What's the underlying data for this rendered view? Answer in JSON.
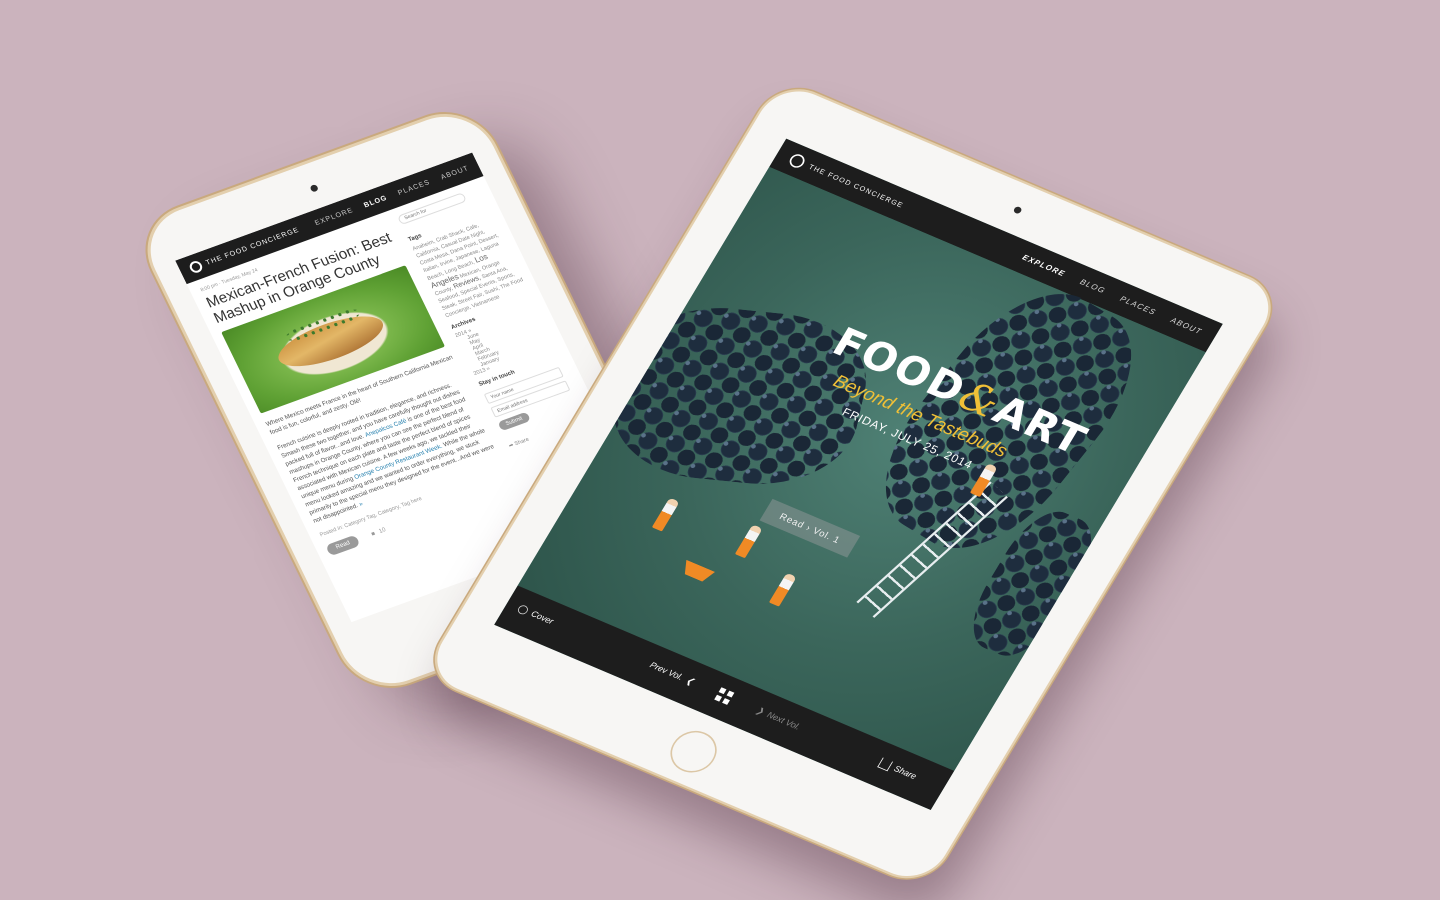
{
  "colors": {
    "background": "#cbb3bd",
    "nav_dark": "#1d1d1d",
    "hero_teal": "#3e6a60",
    "accent_yellow": "#f0c037",
    "link_blue": "#2a83b0",
    "worker_orange": "#f08a25"
  },
  "left_tablet": {
    "nav": {
      "brand": "THE FOOD CONCIERGE",
      "items": [
        "EXPLORE",
        "BLOG",
        "PLACES",
        "ABOUT"
      ],
      "active": "BLOG"
    },
    "post": {
      "meta": "8:00 pm · Tuesday, May 24",
      "title": "Mexican-French Fusion: Best Mashup in Orange County",
      "paragraph1": "Where Mexico meets France in the heart of Southern California Mexican food is fun, colorful, and zesty. Olé!",
      "paragraph2_before": "French cuisine is deeply rooted in tradition, elegance, and richness. Smash these two together, and you have carefully thought out dishes packed full of flavor...and love.",
      "link1": "Anepalcos Café",
      "paragraph2_mid": "is one of the best food mashups in Orange County, where you can see the perfect blend of French technique on each plate and taste the perfect blend of spices associated with Mexican cuisine. A few weeks ago, we tackled their unique menu during",
      "link2": "Orange County Restaurant Week.",
      "paragraph2_after": "While the whole menu looked amazing and we wanted to order everything, we stuck primarily to the special menu they designed for the event...And we were not disappointed.",
      "more_link": "»",
      "footer": "Posted in: Category Tag, Category, Tag here",
      "read_label": "Read",
      "comment_count": "10"
    },
    "sidebar": {
      "search_placeholder": "Search for",
      "tags_heading": "Tags",
      "tags_text": "Anaheim, Crab Shack, Cafe, California, Casual Date Night, Costa Mesa, Dana Point, Dessert, Italian, Irvine, Japanese, Laguna Beach, Long Beach,",
      "tags_big": "Los Angeles",
      "tags_more": "Mexican, Orange County,",
      "tags_reviews": "Reviews,",
      "tags_end": "Santa Ana, Seafood, Special Events, Sports, Steak, Street Fair, Sushi, The Food Concierge, Vietnamese",
      "archives_heading": "Archives",
      "archives": [
        "2014 »",
        "June",
        "May",
        "April",
        "March",
        "February",
        "January",
        "2013 »"
      ],
      "touch_heading": "Stay in touch",
      "name_placeholder": "Your name",
      "email_placeholder": "Email address",
      "submit_label": "Submit",
      "share_label": "Share"
    }
  },
  "right_tablet": {
    "nav": {
      "brand": "THE FOOD CONCIERGE",
      "items": [
        "EXPLORE",
        "BLOG",
        "PLACES",
        "ABOUT"
      ],
      "active": "EXPLORE"
    },
    "hero": {
      "title_left": "FOOD",
      "title_amp": "&",
      "title_right": "ART",
      "subtitle": "Beyond the Tastebuds",
      "date": "FRIDAY, JULY 25, 2014",
      "read_button": "Read  ›  Vol. 1"
    },
    "bottom_bar": {
      "cover": "Cover",
      "prev": "Prev Vol.",
      "next": "Next Vol.",
      "share": "Share"
    }
  }
}
